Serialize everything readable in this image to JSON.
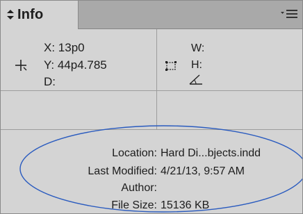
{
  "panel": {
    "tab_label": "Info",
    "tab_arrows": "◇",
    "menu_icon": "panel-menu-icon"
  },
  "position": {
    "x": "X: 13p0",
    "y": "Y: 44p4.785",
    "d": "D:"
  },
  "dimensions": {
    "w": "W:",
    "h": "H:"
  },
  "document": {
    "location_label": "Location:",
    "location_value": "Hard Di...bjects.indd",
    "modified_label": "Last Modified:",
    "modified_value": "4/21/13, 9:57 AM",
    "author_label": "Author:",
    "author_value": "",
    "size_label": "File Size:",
    "size_value": "15136 KB"
  },
  "colors": {
    "panel_bg": "#d4d4d4",
    "tabbar_bg": "#a9a9a9",
    "annotation_ellipse": "#2a5bbf"
  }
}
